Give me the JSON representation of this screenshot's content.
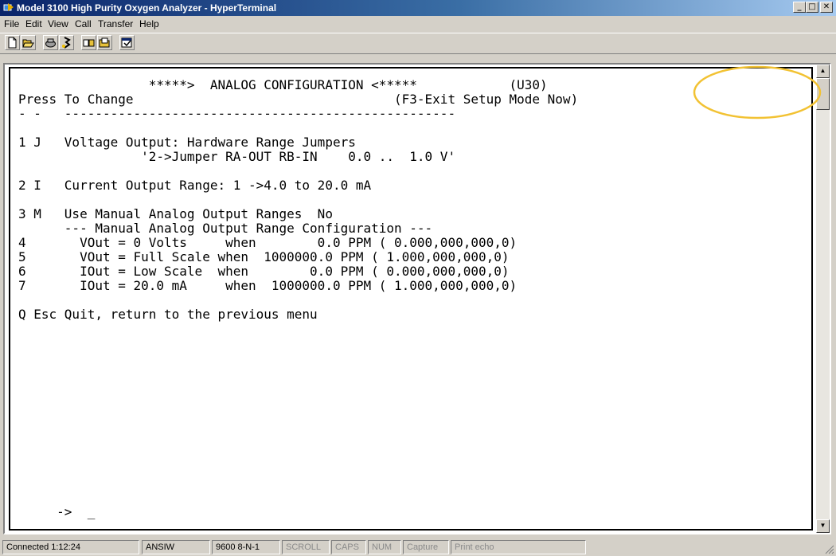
{
  "window": {
    "title": "Model 3100 High Purity Oxygen Analyzer - HyperTerminal",
    "minimize_glyph": "_",
    "maximize_glyph": "□",
    "close_glyph": "✕"
  },
  "menu": [
    "File",
    "Edit",
    "View",
    "Call",
    "Transfer",
    "Help"
  ],
  "toolbar": {
    "icons": [
      "new-icon",
      "open-icon",
      "disconnect-icon",
      "connect-icon",
      "send-icon",
      "receive-icon",
      "properties-icon"
    ]
  },
  "terminal": {
    "lines": [
      "                 *****>  ANALOG CONFIGURATION <*****            (U30)",
      "Press To Change                                  (F3-Exit Setup Mode Now)",
      "- -   ---------------------------------------------------",
      "",
      "1 J   Voltage Output: Hardware Range Jumpers",
      "                '2->Jumper RA-OUT RB-IN    0.0 ..  1.0 V'",
      "",
      "2 I   Current Output Range: 1 ->4.0 to 20.0 mA",
      "",
      "3 M   Use Manual Analog Output Ranges  No",
      "      --- Manual Analog Output Range Configuration ---",
      "4       VOut = 0 Volts     when        0.0 PPM ( 0.000,000,000,0)",
      "5       VOut = Full Scale when  1000000.0 PPM ( 1.000,000,000,0)",
      "6       IOut = Low Scale  when        0.0 PPM ( 0.000,000,000,0)",
      "7       IOut = 20.0 mA     when  1000000.0 PPM ( 1.000,000,000,0)",
      "",
      "Q Esc Quit, return to the previous menu",
      "",
      "",
      "",
      "",
      "",
      "",
      "",
      "",
      "",
      "",
      "     ->  _"
    ]
  },
  "scrollbar": {
    "up_glyph": "▲",
    "down_glyph": "▼"
  },
  "status": {
    "connection": "Connected 1:12:24",
    "emulation": "ANSIW",
    "settings": "9600 8-N-1",
    "scroll": "SCROLL",
    "caps": "CAPS",
    "num": "NUM",
    "capture": "Capture",
    "print": "Print echo"
  },
  "colors": {
    "highlight": "#f2c233",
    "titlebar": "#0a246a"
  }
}
